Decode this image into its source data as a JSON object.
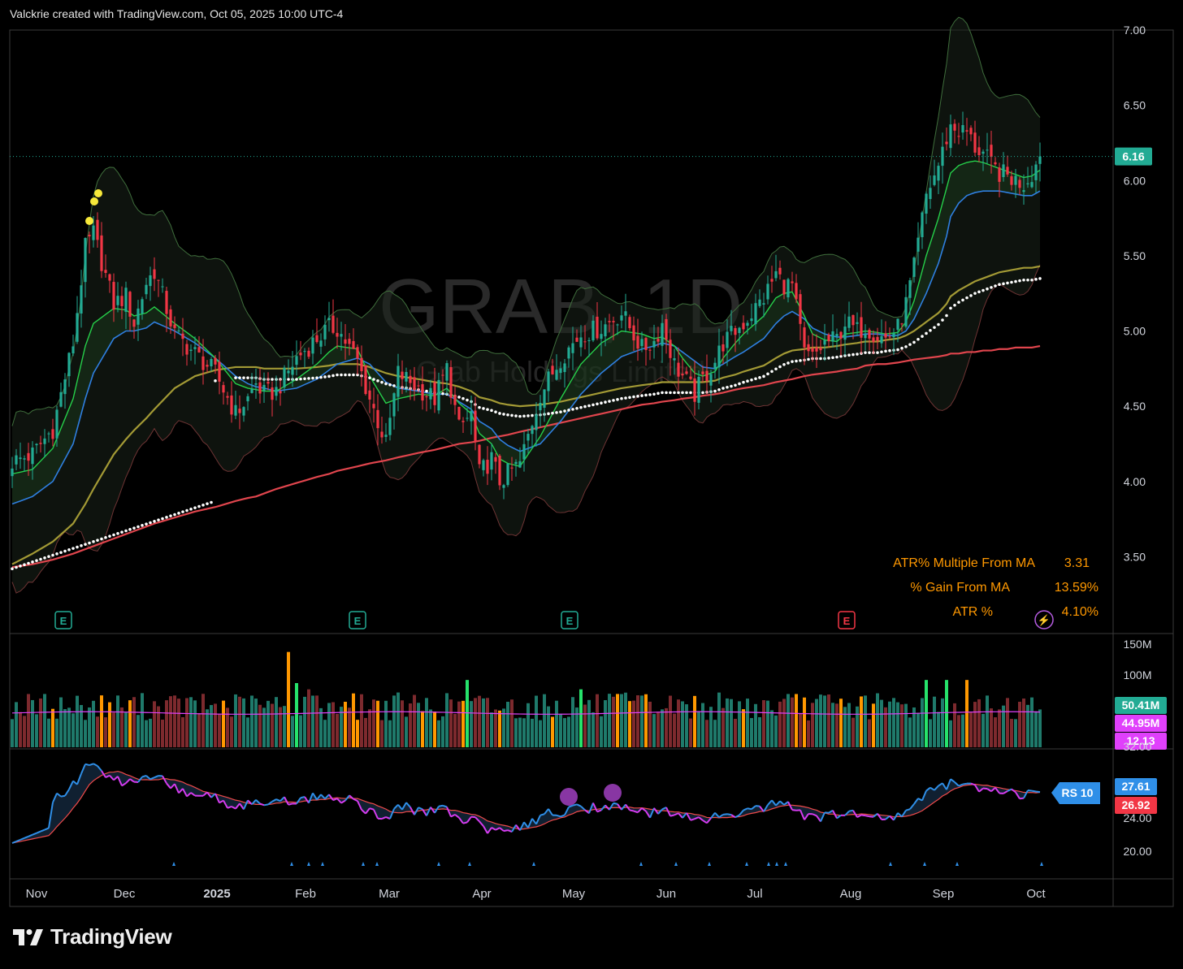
{
  "header": {
    "caption": "Valckrie created with TradingView.com, Oct 05, 2025 10:00 UTC-4"
  },
  "footer": {
    "brand": "TradingView"
  },
  "watermark": {
    "symbol": "GRAB, 1D",
    "name": "Grab Holdings Limited"
  },
  "colors": {
    "up": "#22ab94",
    "down": "#f23645",
    "ma10": "#26d04a",
    "ma21": "#2f7fe0",
    "ma50": "#a39a35",
    "ma200": "#e0454d",
    "volAvg": "#e040fb",
    "rs": "#2f8fe8",
    "rsMa": "#f04a4a",
    "accent": "#ff9800"
  },
  "chart_data": {
    "type": "candlestick",
    "symbol": "GRAB",
    "interval": "1D",
    "price_axis": {
      "ticks": [
        "7.00",
        "6.50",
        "6.00",
        "5.50",
        "5.00",
        "4.50",
        "4.00",
        "3.50"
      ],
      "ylim": [
        3.0,
        7.0
      ]
    },
    "time_axis": [
      "Nov",
      "Dec",
      "2025",
      "Feb",
      "Mar",
      "Apr",
      "May",
      "Jun",
      "Jul",
      "Aug",
      "Sep",
      "Oct"
    ],
    "last_price": "6.16",
    "earnings_markers": [
      "E",
      "E",
      "E",
      "E"
    ],
    "info_table": [
      {
        "label": "ATR% Multiple From MA",
        "value": "3.31"
      },
      {
        "label": "% Gain From MA",
        "value": "13.59%"
      },
      {
        "label": "ATR %",
        "value": "4.10%"
      }
    ],
    "volume": {
      "ticks": [
        "150M",
        "100M"
      ],
      "labels": [
        "50.41M",
        "44.95M",
        "12.13"
      ]
    },
    "rs": {
      "ticks": [
        "32.00",
        "24.00",
        "20.00"
      ],
      "name": "RS 10",
      "labels": [
        "27.61",
        "26.92"
      ]
    },
    "price_series": {
      "x": [
        0,
        5,
        10,
        15,
        18,
        20,
        25,
        28,
        30,
        33,
        35,
        40,
        45,
        50,
        55,
        58,
        60,
        62,
        65,
        70,
        75,
        78,
        80,
        85,
        88,
        92,
        95,
        100,
        104,
        107,
        110,
        113,
        115,
        118,
        120,
        122,
        125,
        130,
        135,
        140,
        145,
        150,
        155,
        158,
        160,
        163,
        165,
        168,
        170,
        173,
        175,
        178,
        180,
        185,
        188,
        190,
        192,
        195,
        197,
        200,
        203,
        205,
        208,
        210,
        213,
        215,
        218,
        220,
        222,
        225,
        228,
        230,
        231,
        233,
        235,
        237,
        239,
        241,
        243,
        245,
        247,
        249,
        251,
        253
      ],
      "close": [
        4.13,
        4.18,
        4.35,
        4.92,
        5.55,
        5.65,
        5.18,
        5.23,
        5.05,
        5.32,
        5.4,
        4.98,
        4.85,
        4.72,
        4.45,
        4.55,
        4.65,
        4.58,
        4.6,
        4.82,
        4.95,
        5.02,
        5.02,
        4.8,
        4.55,
        4.25,
        4.72,
        4.62,
        4.55,
        4.75,
        4.35,
        4.45,
        4.05,
        4.15,
        4.0,
        4.05,
        4.12,
        4.58,
        4.82,
        4.98,
        5.02,
        5.12,
        4.88,
        4.93,
        5.05,
        4.78,
        4.7,
        4.58,
        4.68,
        4.8,
        4.92,
        5.0,
        5.05,
        5.22,
        5.38,
        5.31,
        5.3,
        4.85,
        4.82,
        4.92,
        4.95,
        5.06,
        5.0,
        5.03,
        4.97,
        4.95,
        5.02,
        5.18,
        5.42,
        5.9,
        6.1,
        6.28,
        6.36,
        6.33,
        6.32,
        6.22,
        6.18,
        6.1,
        6.05,
        6.03,
        6.0,
        5.98,
        6.05,
        6.16
      ],
      "ma10": [
        4.05,
        4.08,
        4.22,
        4.55,
        4.9,
        5.05,
        5.15,
        5.14,
        5.1,
        5.12,
        5.16,
        5.05,
        4.95,
        4.82,
        4.65,
        4.62,
        4.61,
        4.6,
        4.6,
        4.68,
        4.78,
        4.86,
        4.9,
        4.88,
        4.7,
        4.52,
        4.55,
        4.58,
        4.57,
        4.62,
        4.52,
        4.45,
        4.32,
        4.25,
        4.15,
        4.12,
        4.1,
        4.3,
        4.55,
        4.78,
        4.92,
        5.0,
        4.98,
        4.95,
        4.96,
        4.9,
        4.82,
        4.72,
        4.7,
        4.73,
        4.82,
        4.92,
        4.98,
        5.1,
        5.22,
        5.25,
        5.26,
        5.1,
        4.98,
        4.94,
        4.93,
        4.98,
        4.99,
        5.0,
        4.99,
        4.98,
        4.99,
        5.06,
        5.2,
        5.5,
        5.75,
        5.95,
        6.05,
        6.1,
        6.12,
        6.13,
        6.12,
        6.1,
        6.08,
        6.06,
        6.04,
        6.02,
        6.03,
        6.07
      ],
      "ma21": [
        3.85,
        3.9,
        4.0,
        4.25,
        4.55,
        4.72,
        4.95,
        5.0,
        5.0,
        5.02,
        5.06,
        5.0,
        4.92,
        4.82,
        4.7,
        4.65,
        4.63,
        4.62,
        4.6,
        4.62,
        4.68,
        4.74,
        4.78,
        4.82,
        4.78,
        4.66,
        4.62,
        4.6,
        4.58,
        4.58,
        4.53,
        4.48,
        4.4,
        4.35,
        4.28,
        4.24,
        4.2,
        4.25,
        4.4,
        4.58,
        4.72,
        4.83,
        4.88,
        4.9,
        4.92,
        4.9,
        4.86,
        4.8,
        4.76,
        4.75,
        4.78,
        4.83,
        4.86,
        4.95,
        5.05,
        5.1,
        5.13,
        5.08,
        5.02,
        4.98,
        4.96,
        4.96,
        4.97,
        4.98,
        4.98,
        4.97,
        4.97,
        5.0,
        5.08,
        5.25,
        5.45,
        5.63,
        5.76,
        5.85,
        5.9,
        5.92,
        5.93,
        5.93,
        5.93,
        5.92,
        5.91,
        5.9,
        5.9,
        5.93
      ],
      "ma50": [
        3.45,
        3.52,
        3.6,
        3.72,
        3.85,
        3.95,
        4.18,
        4.28,
        4.34,
        4.42,
        4.48,
        4.62,
        4.7,
        4.74,
        4.76,
        4.76,
        4.76,
        4.75,
        4.75,
        4.75,
        4.76,
        4.77,
        4.78,
        4.78,
        4.76,
        4.72,
        4.7,
        4.68,
        4.66,
        4.65,
        4.63,
        4.6,
        4.56,
        4.54,
        4.52,
        4.51,
        4.5,
        4.51,
        4.53,
        4.56,
        4.59,
        4.62,
        4.64,
        4.65,
        4.66,
        4.66,
        4.66,
        4.66,
        4.66,
        4.67,
        4.69,
        4.71,
        4.73,
        4.77,
        4.82,
        4.85,
        4.87,
        4.88,
        4.89,
        4.89,
        4.9,
        4.91,
        4.92,
        4.93,
        4.93,
        4.94,
        4.95,
        4.97,
        5.0,
        5.06,
        5.12,
        5.18,
        5.23,
        5.27,
        5.3,
        5.33,
        5.35,
        5.37,
        5.39,
        5.4,
        5.41,
        5.42,
        5.42,
        5.43
      ],
      "ma200": [
        3.43,
        3.45,
        3.48,
        3.52,
        3.55,
        3.57,
        3.62,
        3.65,
        3.67,
        3.7,
        3.72,
        3.76,
        3.8,
        3.83,
        3.87,
        3.89,
        3.9,
        3.92,
        3.95,
        3.99,
        4.03,
        4.05,
        4.07,
        4.1,
        4.12,
        4.14,
        4.16,
        4.19,
        4.21,
        4.23,
        4.25,
        4.26,
        4.27,
        4.29,
        4.3,
        4.31,
        4.33,
        4.36,
        4.39,
        4.42,
        4.45,
        4.48,
        4.51,
        4.52,
        4.53,
        4.54,
        4.55,
        4.56,
        4.57,
        4.58,
        4.59,
        4.61,
        4.62,
        4.64,
        4.66,
        4.67,
        4.68,
        4.7,
        4.71,
        4.72,
        4.73,
        4.74,
        4.75,
        4.77,
        4.78,
        4.78,
        4.79,
        4.8,
        4.81,
        4.82,
        4.83,
        4.84,
        4.85,
        4.85,
        4.86,
        4.86,
        4.87,
        4.87,
        4.88,
        4.88,
        4.89,
        4.89,
        4.89,
        4.9
      ]
    }
  }
}
